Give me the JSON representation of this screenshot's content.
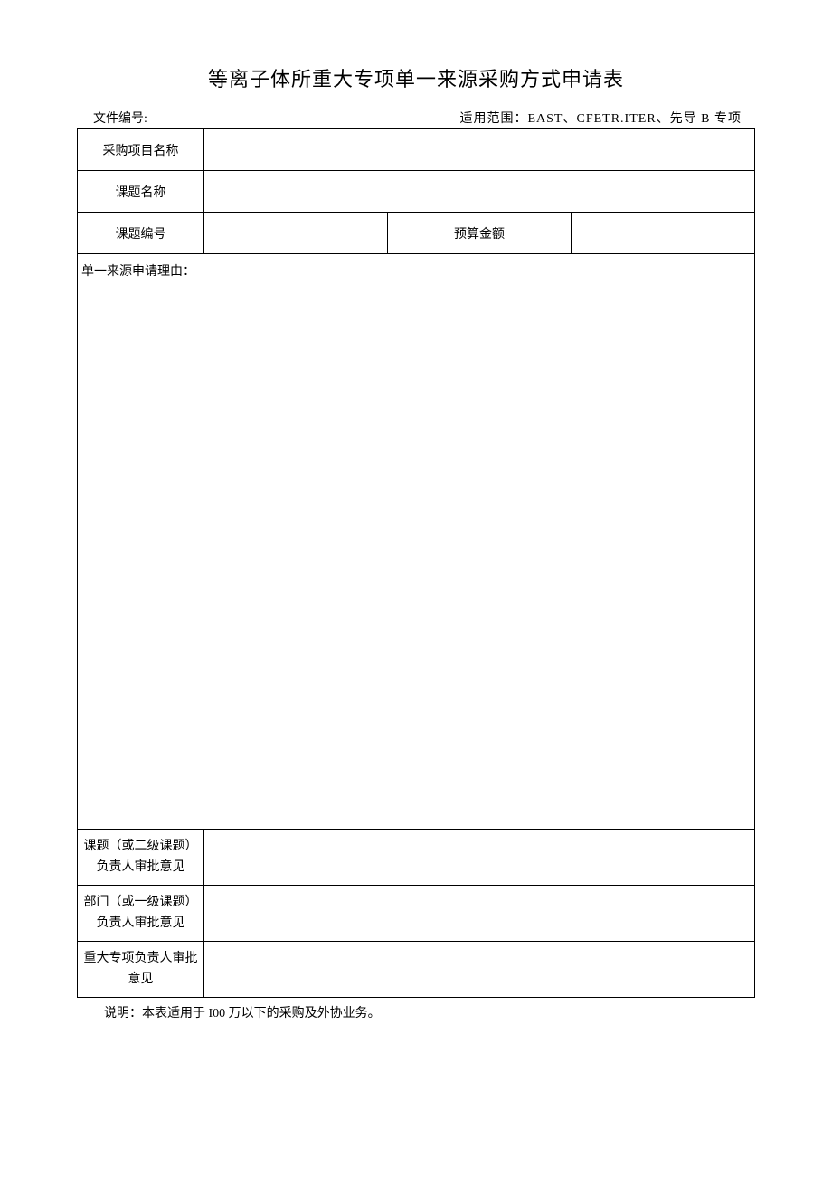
{
  "title": "等离子体所重大专项单一来源采购方式申请表",
  "meta": {
    "file_no_label": "文件编号:",
    "file_no_value": "",
    "scope_label": "适用范围：EAST、CFETR.ITER、先导 B 专项"
  },
  "rows": {
    "proj_name_label": "采购项目名称",
    "proj_name_value": "",
    "topic_name_label": "课题名称",
    "topic_name_value": "",
    "topic_no_label": "课题编号",
    "topic_no_value": "",
    "budget_label": "预算金额",
    "budget_value": "",
    "reason_header": "单一来源申请理由：",
    "reason_body": "",
    "approval1_label": "课题（或二级课题）负责人审批意见",
    "approval1_value": "",
    "approval2_label": "部门（或一级课题）负责人审批意见",
    "approval2_value": "",
    "approval3_label": "重大专项负责人审批意见",
    "approval3_value": ""
  },
  "note": "说明：本表适用于 I00 万以下的采购及外协业务。"
}
